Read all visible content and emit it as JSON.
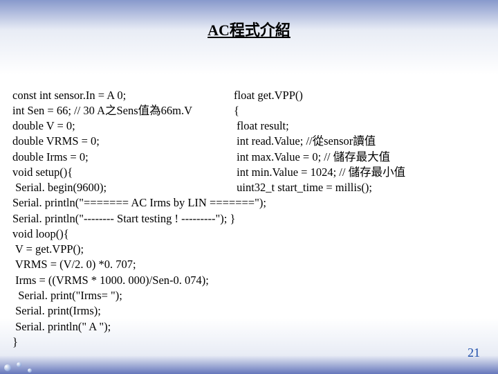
{
  "title": "AC程式介紹",
  "code": {
    "left": [
      "const int sensor.In = A 0;",
      "int Sen = 66; // 30 A之Sens值為66m.V",
      "double V = 0;",
      "double VRMS = 0;",
      "double Irms = 0;",
      "void setup(){",
      " Serial. begin(9600);"
    ],
    "right": [
      "float get.VPP()",
      "{",
      " float result;",
      " int read.Value; //從sensor讀值",
      " int max.Value = 0; // 儲存最大值",
      " int min.Value = 1024; // 儲存最小值",
      " uint32_t start_time = millis();"
    ],
    "full": [
      "Serial. println(\"======= AC Irms by LIN =======\");",
      "Serial. println(\"-------- Start testing ! ---------\"); }",
      "void loop(){",
      " V = get.VPP();",
      " VRMS = (V/2. 0) *0. 707;",
      " Irms = ((VRMS * 1000. 000)/Sen-0. 074);",
      "  Serial. print(\"Irms= \");",
      " Serial. print(Irms);",
      " Serial. println(\" A \");",
      "}"
    ]
  },
  "page_number": "21"
}
